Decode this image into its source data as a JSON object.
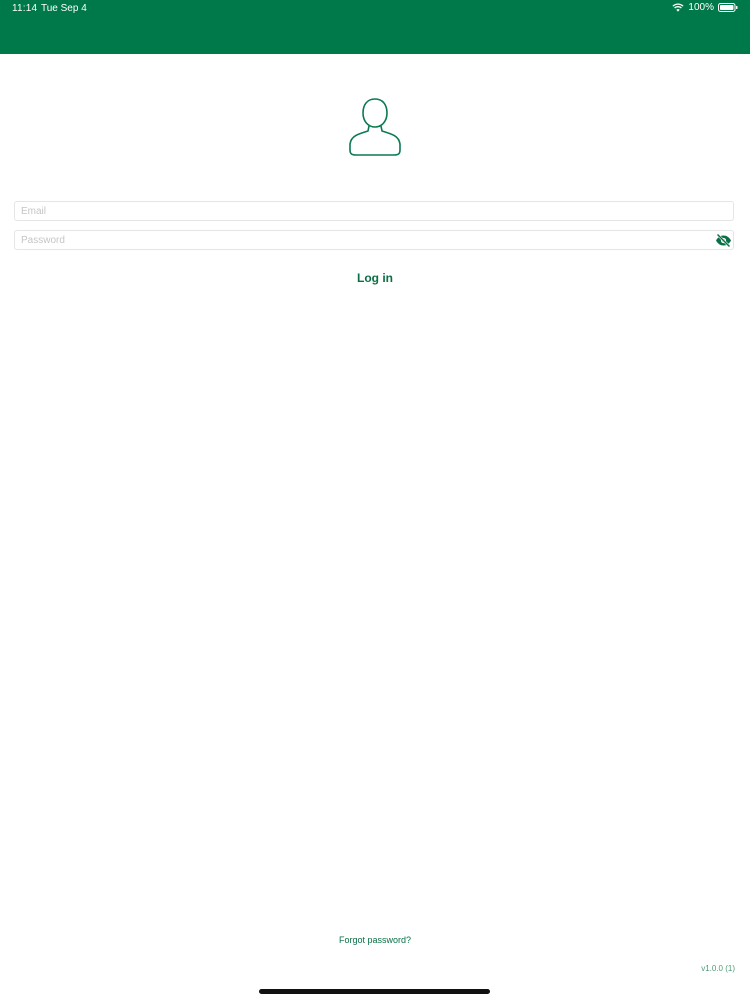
{
  "status_bar": {
    "time": "11:14",
    "date": "Tue Sep 4",
    "battery": "100%",
    "wifi_icon": "wifi-icon",
    "battery_icon": "battery-icon",
    "color": "#00794a"
  },
  "login": {
    "avatar_icon": "user-icon",
    "email_placeholder": "Email",
    "password_placeholder": "Password",
    "visibility_icon": "eye-off-icon",
    "submit_label": "Log in",
    "accent_color": "#0a6f45"
  },
  "footer": {
    "forgot_label": "Forgot password?",
    "version": "v1.0.0 (1)"
  }
}
